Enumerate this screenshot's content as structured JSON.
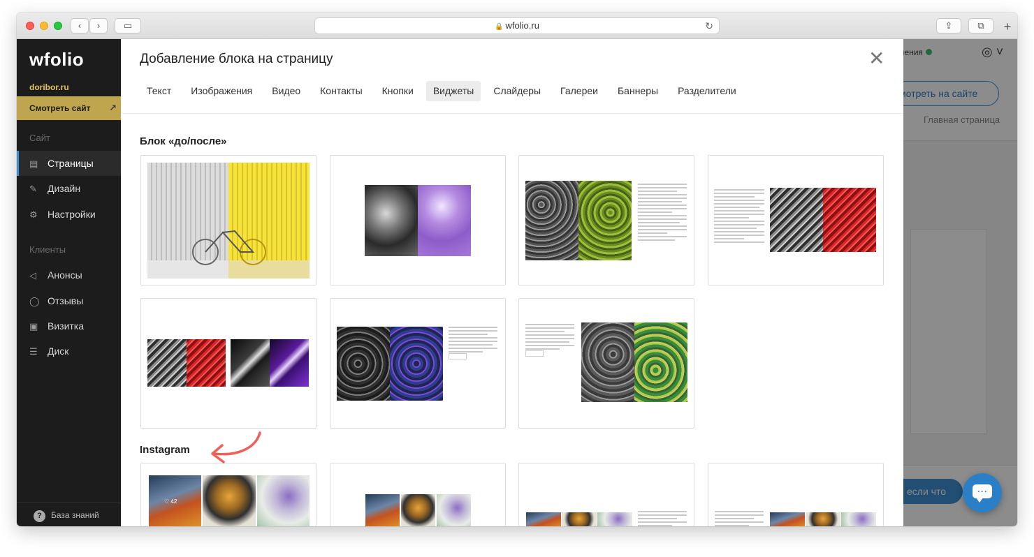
{
  "browser": {
    "url": "wfolio.ru"
  },
  "sidebar": {
    "logo": "wfolio",
    "site_name": "doribor.ru",
    "view_site": "Смотреть сайт",
    "section_site": "Сайт",
    "items_site": [
      {
        "label": "Страницы",
        "icon": "document-icon",
        "active": true
      },
      {
        "label": "Дизайн",
        "icon": "brush-icon"
      },
      {
        "label": "Настройки",
        "icon": "gear-icon"
      }
    ],
    "section_clients": "Клиенты",
    "items_clients": [
      {
        "label": "Анонсы",
        "icon": "megaphone-icon"
      },
      {
        "label": "Отзывы",
        "icon": "chat-bubbles-icon"
      },
      {
        "label": "Визитка",
        "icon": "id-card-icon"
      },
      {
        "label": "Диск",
        "icon": "database-icon"
      }
    ],
    "knowledge_base": "База знаний"
  },
  "background": {
    "updates": "новления",
    "view_button": "мотреть на сайте",
    "breadcrumb": "Главная страница",
    "if_button": "если что"
  },
  "modal": {
    "title": "Добавление блока на страницу",
    "tabs": [
      "Текст",
      "Изображения",
      "Видео",
      "Контакты",
      "Кнопки",
      "Виджеты",
      "Слайдеры",
      "Галереи",
      "Баннеры",
      "Разделители"
    ],
    "active_tab": "Виджеты",
    "section_before_after": "Блок «до/после»",
    "section_instagram": "Instagram",
    "like_count": "42"
  },
  "colors": {
    "accent": "#3d8ecf",
    "sidebar_bg": "#1c1c1c",
    "gold": "#bfa54e",
    "arrow": "#f0605a"
  }
}
